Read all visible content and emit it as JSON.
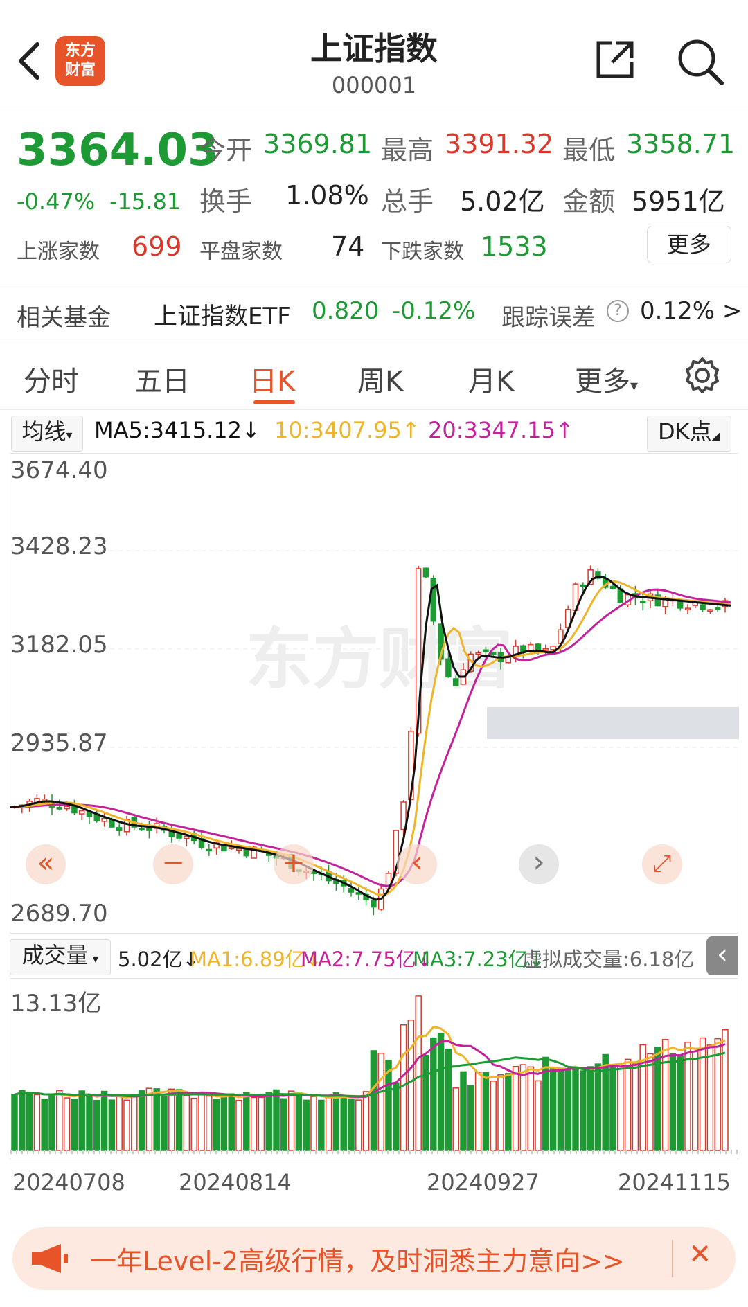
{
  "header": {
    "title": "上证指数",
    "code": "000001",
    "logo_text_1": "东方",
    "logo_text_2": "财富"
  },
  "quote": {
    "price": "3364.03",
    "change_pct": "-0.47%",
    "change": "-15.81",
    "open_label": "今开",
    "open": "3369.81",
    "high_label": "最高",
    "high": "3391.32",
    "low_label": "最低",
    "low": "3358.71",
    "turnover_label": "换手",
    "turnover": "1.08%",
    "volume_label": "总手",
    "volume": "5.02亿",
    "amount_label": "金额",
    "amount": "5951亿",
    "up_label": "上涨家数",
    "up": "699",
    "flat_label": "平盘家数",
    "flat": "74",
    "down_label": "下跌家数",
    "down": "1533",
    "more_label": "更多"
  },
  "fund": {
    "label": "相关基金",
    "name": "上证指数ETF",
    "price": "0.820",
    "pct": "-0.12%",
    "track_label": "跟踪误差",
    "help": "?",
    "track_value": "0.12% >"
  },
  "tabs": [
    "分时",
    "五日",
    "日K",
    "周K",
    "月K",
    "更多"
  ],
  "ma_row": {
    "selector": "均线",
    "ma5": "MA5:3415.12↓",
    "ma10": "10:3407.95↑",
    "ma20": "20:3347.15↑",
    "dk": "DK点"
  },
  "chart_data": {
    "type": "candlestick",
    "y_labels": [
      "3674.40",
      "3428.23",
      "3182.05",
      "2935.87",
      "2689.70"
    ],
    "x_labels": [
      "20240708",
      "20240814",
      "20240927",
      "20241115"
    ],
    "watermark": "东方财富"
  },
  "vol_row": {
    "selector": "成交量",
    "vol": "5.02亿↓",
    "ma1": "MA1:6.89亿↓",
    "ma2": "MA2:7.75亿↓",
    "ma3": "MA3:7.23亿↓",
    "virtual": "虚拟成交量:6.18亿"
  },
  "vol_chart": {
    "max_label": "13.13亿"
  },
  "controls": {
    "fast_back": "«",
    "zoom_out": "−",
    "zoom_in": "+",
    "prev": "‹",
    "next": "›",
    "expand": "⤢"
  },
  "ad": {
    "text": "一年Level-2高级行情，及时洞悉主力意向>>",
    "close": "✕"
  },
  "colors": {
    "up": "#d8392b",
    "down": "#1e9a34",
    "accent": "#e8542a",
    "ma5": "#111111",
    "ma10": "#f0b429",
    "ma20": "#c2229a"
  }
}
